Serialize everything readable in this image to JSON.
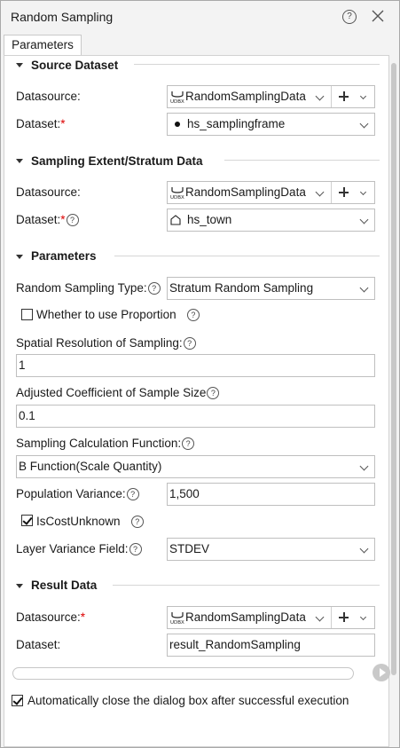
{
  "window": {
    "title": "Random Sampling"
  },
  "tabs": [
    {
      "label": "Parameters"
    }
  ],
  "sections": {
    "source": {
      "title": "Source Dataset",
      "datasource_label": "Datasource:",
      "datasource_value": "RandomSamplingData",
      "dataset_label": "Dataset:",
      "dataset_value": "hs_samplingframe"
    },
    "extent": {
      "title": "Sampling Extent/Stratum Data",
      "datasource_label": "Datasource:",
      "datasource_value": "RandomSamplingData",
      "dataset_label": "Dataset:",
      "dataset_value": "hs_town"
    },
    "parameters": {
      "title": "Parameters",
      "sampling_type_label": "Random Sampling Type:",
      "sampling_type_value": "Stratum Random Sampling",
      "use_proportion_label": "Whether to use Proportion",
      "use_proportion_checked": false,
      "resolution_label": "Spatial Resolution of Sampling:",
      "resolution_value": "1",
      "coefficient_label": "Adjusted Coefficient of Sample Size",
      "coefficient_value": "0.1",
      "calc_function_label": "Sampling Calculation Function:",
      "calc_function_value": "B Function(Scale Quantity)",
      "population_variance_label": "Population Variance:",
      "population_variance_value": "1,500",
      "cost_unknown_label": "IsCostUnknown",
      "cost_unknown_checked": true,
      "layer_variance_label": "Layer Variance Field:",
      "layer_variance_value": "STDEV"
    },
    "result": {
      "title": "Result Data",
      "datasource_label": "Datasource:",
      "datasource_value": "RandomSamplingData",
      "dataset_label": "Dataset:",
      "dataset_value": "result_RandomSampling"
    }
  },
  "footer": {
    "auto_close_label": "Automatically close the dialog box after successful execution",
    "auto_close_checked": true
  },
  "glyphs": {
    "required": "*",
    "help": "?",
    "datasource_icon": "UDBX"
  }
}
